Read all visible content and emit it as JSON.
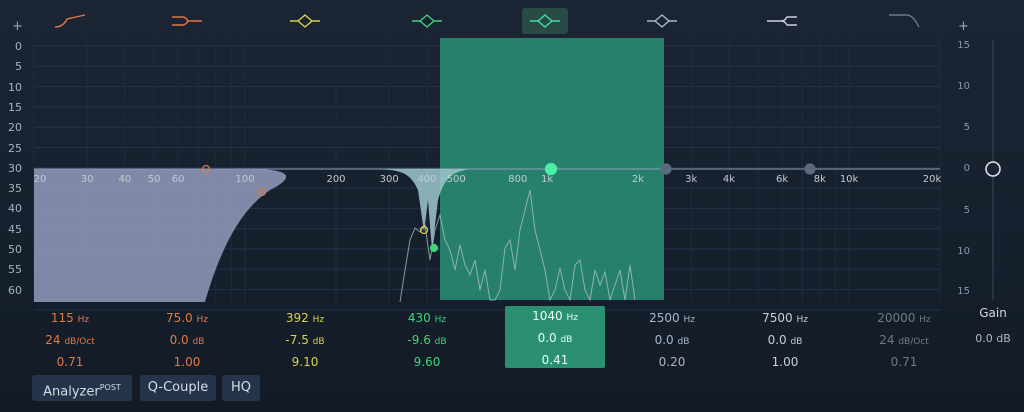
{
  "bands": [
    {
      "type": "low-cut",
      "color": "#e07a45",
      "freq": "115",
      "freq_unit": "Hz",
      "gain": "24",
      "gain_unit": "dB/Oct",
      "q": "0.71"
    },
    {
      "type": "low-shelf",
      "color": "#e07a45",
      "freq": "75.0",
      "freq_unit": "Hz",
      "gain": "0.0",
      "gain_unit": "dB",
      "q": "1.00"
    },
    {
      "type": "bell",
      "color": "#d9d24a",
      "freq": "392",
      "freq_unit": "Hz",
      "gain": "-7.5",
      "gain_unit": "dB",
      "q": "9.10"
    },
    {
      "type": "bell",
      "color": "#3fd37a",
      "freq": "430",
      "freq_unit": "Hz",
      "gain": "-9.6",
      "gain_unit": "dB",
      "q": "9.60"
    },
    {
      "type": "bell",
      "color": "#3fe0a0",
      "freq": "1040",
      "freq_unit": "Hz",
      "gain": "0.0",
      "gain_unit": "dB",
      "q": "0.41",
      "selected": true
    },
    {
      "type": "bell",
      "color": "#a9b7c8",
      "freq": "2500",
      "freq_unit": "Hz",
      "gain": "0.0",
      "gain_unit": "dB",
      "q": "0.20"
    },
    {
      "type": "high-shelf",
      "color": "#c7d0da",
      "freq": "7500",
      "freq_unit": "Hz",
      "gain": "0.0",
      "gain_unit": "dB",
      "q": "1.00"
    },
    {
      "type": "high-cut",
      "color": "#6f7a88",
      "freq": "20000",
      "freq_unit": "Hz",
      "gain": "24",
      "gain_unit": "dB/Oct",
      "q": "0.71"
    }
  ],
  "analyzer_scale": [
    "0",
    "5",
    "10",
    "15",
    "20",
    "25",
    "30",
    "35",
    "40",
    "45",
    "50",
    "55",
    "60"
  ],
  "gain_scale": [
    "15",
    "10",
    "5",
    "0",
    "5",
    "10",
    "15"
  ],
  "freq_labels": [
    "20",
    "30",
    "40",
    "50",
    "60",
    "100",
    "200",
    "300",
    "400",
    "500",
    "800",
    "1k",
    "2k",
    "3k",
    "4k",
    "6k",
    "8k",
    "10k",
    "20k"
  ],
  "buttons": {
    "analyzer": "Analyzer",
    "analyzer_badge": "POST",
    "q_couple": "Q-Couple",
    "hq": "HQ"
  },
  "gain": {
    "label": "Gain",
    "value": "0.0 dB"
  },
  "plus_sign": "+"
}
